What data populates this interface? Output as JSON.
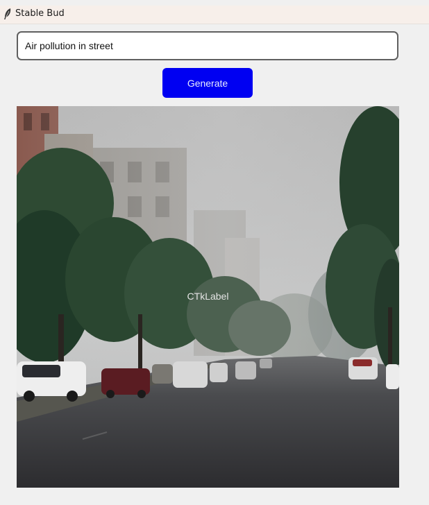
{
  "window": {
    "title": "Stable Bud",
    "app_icon": "feather-icon"
  },
  "prompt": {
    "value": "Air pollution in street",
    "placeholder": ""
  },
  "generate_button": {
    "label": "Generate",
    "color": "#0000f2"
  },
  "image_area": {
    "label": "CTkLabel"
  }
}
